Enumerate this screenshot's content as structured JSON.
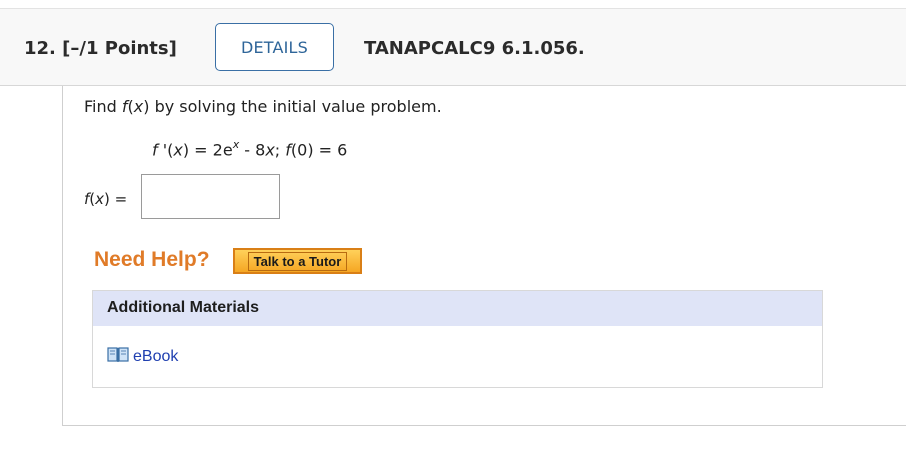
{
  "header": {
    "question_number": "12.",
    "points": "[–/1 Points]",
    "details_label": "DETAILS",
    "code": "TANAPCALC9 6.1.056."
  },
  "question": {
    "prompt_pre": "Find ",
    "prompt_func": "f",
    "prompt_mid": "(",
    "prompt_var": "x",
    "prompt_post": ") by solving the initial value problem.",
    "eq_f": "f",
    "eq_prime": " '(",
    "eq_x": "x",
    "eq_mid": ") = 2e",
    "eq_exp": "x",
    "eq_minus": " - 8",
    "eq_x2": "x",
    "eq_semi": "; ",
    "eq_f0": "f",
    "eq_end": "(0) = 6",
    "answer_label_f": "f",
    "answer_label_open": "(",
    "answer_label_x": "x",
    "answer_label_end": ") =",
    "answer_value": ""
  },
  "help": {
    "title": "Need Help?",
    "tutor_button": "Talk to a Tutor"
  },
  "additional_materials": {
    "title": "Additional Materials",
    "items": [
      {
        "label": "eBook",
        "icon": "book-icon"
      }
    ]
  },
  "colors": {
    "accent_blue": "#2e6599",
    "help_orange": "#e07b28",
    "materials_header": "#dfe4f7",
    "link_blue": "#1f3fb0"
  }
}
